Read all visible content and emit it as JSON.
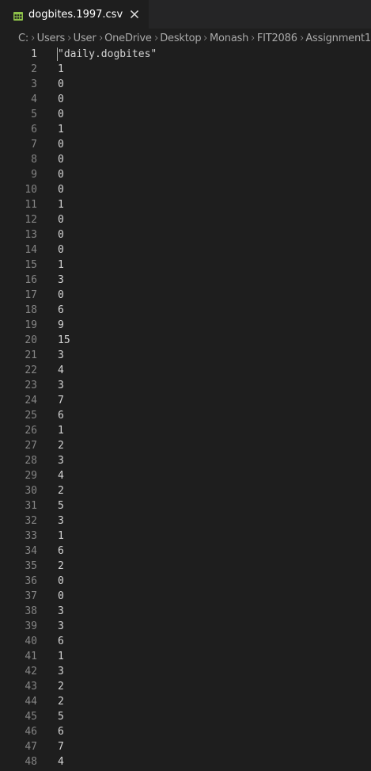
{
  "tab": {
    "filename": "dogbites.1997.csv",
    "icon": "table-file-icon",
    "icon_color": "#8dc149"
  },
  "breadcrumbs": [
    "C:",
    "Users",
    "User",
    "OneDrive",
    "Desktop",
    "Monash",
    "FIT2086",
    "Assignment1"
  ],
  "editor": {
    "current_line": 1,
    "lines": [
      {
        "n": "1",
        "text": "\"daily.dogbites\""
      },
      {
        "n": "2",
        "text": "1"
      },
      {
        "n": "3",
        "text": "0"
      },
      {
        "n": "4",
        "text": "0"
      },
      {
        "n": "5",
        "text": "0"
      },
      {
        "n": "6",
        "text": "1"
      },
      {
        "n": "7",
        "text": "0"
      },
      {
        "n": "8",
        "text": "0"
      },
      {
        "n": "9",
        "text": "0"
      },
      {
        "n": "10",
        "text": "0"
      },
      {
        "n": "11",
        "text": "1"
      },
      {
        "n": "12",
        "text": "0"
      },
      {
        "n": "13",
        "text": "0"
      },
      {
        "n": "14",
        "text": "0"
      },
      {
        "n": "15",
        "text": "1"
      },
      {
        "n": "16",
        "text": "3"
      },
      {
        "n": "17",
        "text": "0"
      },
      {
        "n": "18",
        "text": "6"
      },
      {
        "n": "19",
        "text": "9"
      },
      {
        "n": "20",
        "text": "15"
      },
      {
        "n": "21",
        "text": "3"
      },
      {
        "n": "22",
        "text": "4"
      },
      {
        "n": "23",
        "text": "3"
      },
      {
        "n": "24",
        "text": "7"
      },
      {
        "n": "25",
        "text": "6"
      },
      {
        "n": "26",
        "text": "1"
      },
      {
        "n": "27",
        "text": "2"
      },
      {
        "n": "28",
        "text": "3"
      },
      {
        "n": "29",
        "text": "4"
      },
      {
        "n": "30",
        "text": "2"
      },
      {
        "n": "31",
        "text": "5"
      },
      {
        "n": "32",
        "text": "3"
      },
      {
        "n": "33",
        "text": "1"
      },
      {
        "n": "34",
        "text": "6"
      },
      {
        "n": "35",
        "text": "2"
      },
      {
        "n": "36",
        "text": "0"
      },
      {
        "n": "37",
        "text": "0"
      },
      {
        "n": "38",
        "text": "3"
      },
      {
        "n": "39",
        "text": "3"
      },
      {
        "n": "40",
        "text": "6"
      },
      {
        "n": "41",
        "text": "1"
      },
      {
        "n": "42",
        "text": "3"
      },
      {
        "n": "43",
        "text": "2"
      },
      {
        "n": "44",
        "text": "2"
      },
      {
        "n": "45",
        "text": "5"
      },
      {
        "n": "46",
        "text": "6"
      },
      {
        "n": "47",
        "text": "7"
      },
      {
        "n": "48",
        "text": "4"
      }
    ]
  }
}
